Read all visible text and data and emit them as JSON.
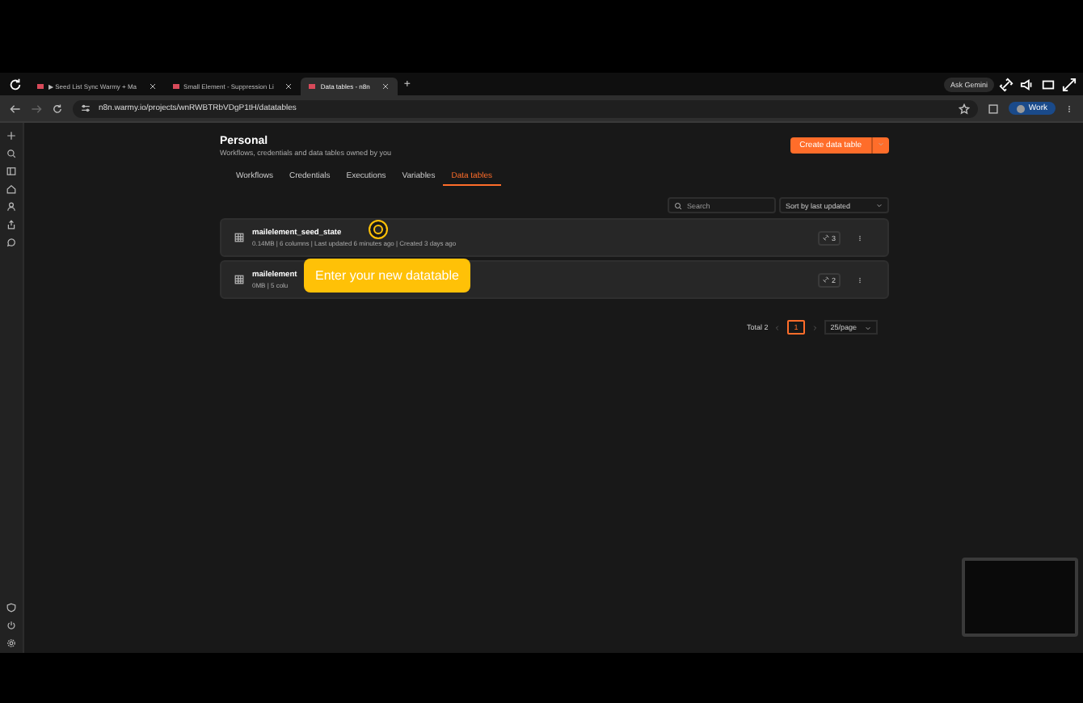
{
  "browser": {
    "tabs": [
      {
        "title": "▶ Seed List Sync Warmy + Ma",
        "selected": false
      },
      {
        "title": "Small Element - Suppression Li",
        "selected": false
      },
      {
        "title": "Data tables - n8n",
        "selected": true
      }
    ],
    "new_tab": "+",
    "ask_gemini": "Ask Gemini",
    "url": "n8n.warmy.io/projects/wnRWBTRbVDgP1tH/datatables",
    "profile": "Work"
  },
  "page": {
    "title": "Personal",
    "subtitle": "Workflows, credentials and data tables owned by you",
    "create_button": "Create data table",
    "tabs": [
      {
        "label": "Workflows",
        "selected": false
      },
      {
        "label": "Credentials",
        "selected": false
      },
      {
        "label": "Executions",
        "selected": false
      },
      {
        "label": "Variables",
        "selected": false
      },
      {
        "label": "Data tables",
        "selected": true
      }
    ],
    "search": {
      "placeholder": "Search"
    },
    "sort": "Sort by last updated",
    "rows": [
      {
        "name": "mailelement_seed_state",
        "meta": "0.14MB | 6 columns | Last updated 6 minutes ago | Created 3 days ago",
        "count": "3"
      },
      {
        "name": "mailelement",
        "meta": "0MB | 5 colu",
        "count": "2"
      }
    ],
    "pagination": {
      "total": "Total 2",
      "pages": [
        {
          "label": "1",
          "selected": true
        }
      ],
      "page_size": "25/page"
    }
  },
  "tooltip": "Enter your new datatable"
}
